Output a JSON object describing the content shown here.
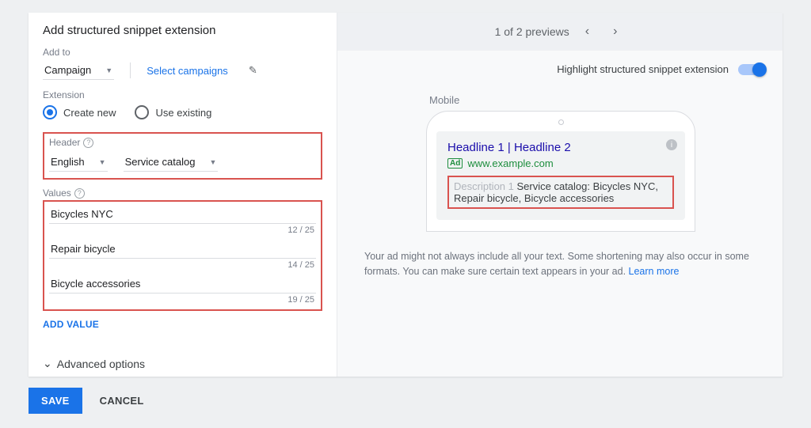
{
  "title": "Add structured snippet extension",
  "add_to": {
    "label": "Add to",
    "value": "Campaign",
    "select_link": "Select campaigns"
  },
  "extension": {
    "label": "Extension",
    "create_new": "Create new",
    "use_existing": "Use existing"
  },
  "header": {
    "label": "Header",
    "language": "English",
    "type": "Service catalog"
  },
  "values": {
    "label": "Values",
    "items": [
      {
        "text": "Bicycles NYC",
        "count": "12 / 25"
      },
      {
        "text": "Repair bicycle",
        "count": "14 / 25"
      },
      {
        "text": "Bicycle accessories",
        "count": "19 / 25"
      }
    ],
    "add": "ADD VALUE"
  },
  "advanced": "Advanced options",
  "footer": {
    "save": "SAVE",
    "cancel": "CANCEL"
  },
  "preview": {
    "counter": "1 of 2 previews",
    "highlight_label": "Highlight structured snippet extension",
    "mobile_label": "Mobile",
    "ad": {
      "headline": "Headline 1 | Headline 2",
      "badge": "Ad",
      "url": "www.example.com",
      "desc_placeholder": "Description 1",
      "desc_text": "Service catalog: Bicycles NYC, Repair bicycle, Bicycle accessories"
    },
    "disclaimer": "Your ad might not always include all your text. Some shortening may also occur in some formats. You can make sure certain text appears in your ad.",
    "learn_more": "Learn more"
  }
}
